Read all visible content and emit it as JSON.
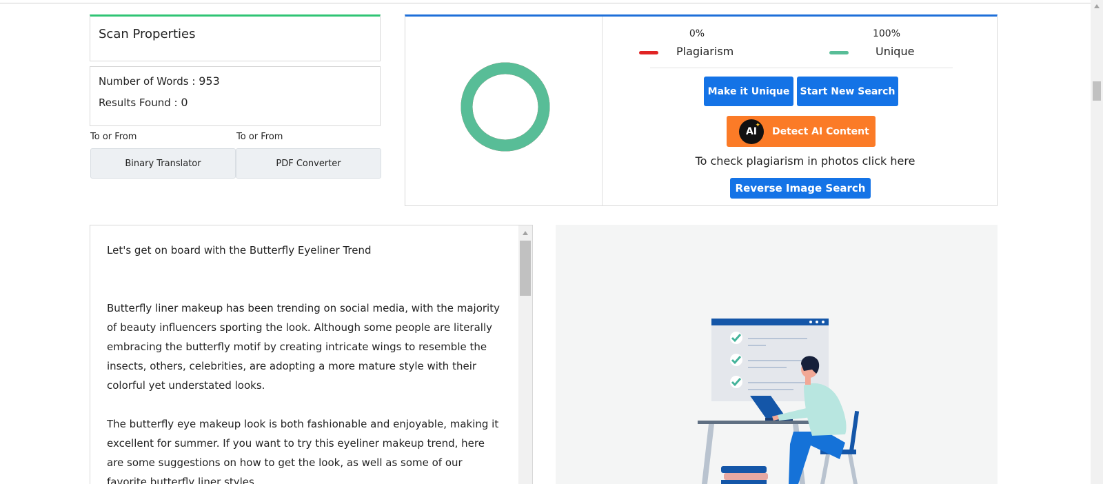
{
  "scan": {
    "title": "Scan Properties",
    "words_label": "Number of Words : ",
    "words_value": "953",
    "results_label": "Results Found : ",
    "results_value": "0"
  },
  "tools": [
    {
      "label": "To or From",
      "button": "Binary Translator"
    },
    {
      "label": "To or From",
      "button": "PDF Converter"
    }
  ],
  "result": {
    "plagiarism_pct": "0%",
    "plagiarism_label": "Plagiarism",
    "plagiarism_color": "#e02424",
    "unique_pct": "100%",
    "unique_label": "Unique",
    "unique_color": "#58bd97",
    "unique_fraction": 1.0,
    "make_unique": "Make it Unique",
    "start_new": "Start New Search",
    "detect_ai": "Detect AI Content",
    "ai_badge": "AI",
    "photo_text": "To check plagiarism in photos click here",
    "reverse_image": "Reverse Image Search"
  },
  "text": {
    "title": "Let's get on board with the Butterfly Eyeliner Trend",
    "p1": "Butterfly liner makeup has been trending on social media, with the majority of beauty influencers sporting the look. Although some people are literally embracing the butterfly motif by creating intricate wings to resemble the insects, others, celebrities, are adopting a more mature style with their colorful yet understated looks.",
    "p2": "The butterfly eye makeup look is both fashionable and enjoyable, making it excellent for summer. If you want to try this eyeliner makeup trend, here are some suggestions on how to get the look, as well as some of our favorite butterfly liner styles."
  },
  "colors": {
    "scan_accent": "#2fc474",
    "result_accent": "#1e6fd9",
    "button_blue": "#1473e6",
    "ai_orange": "#fb7b27"
  }
}
